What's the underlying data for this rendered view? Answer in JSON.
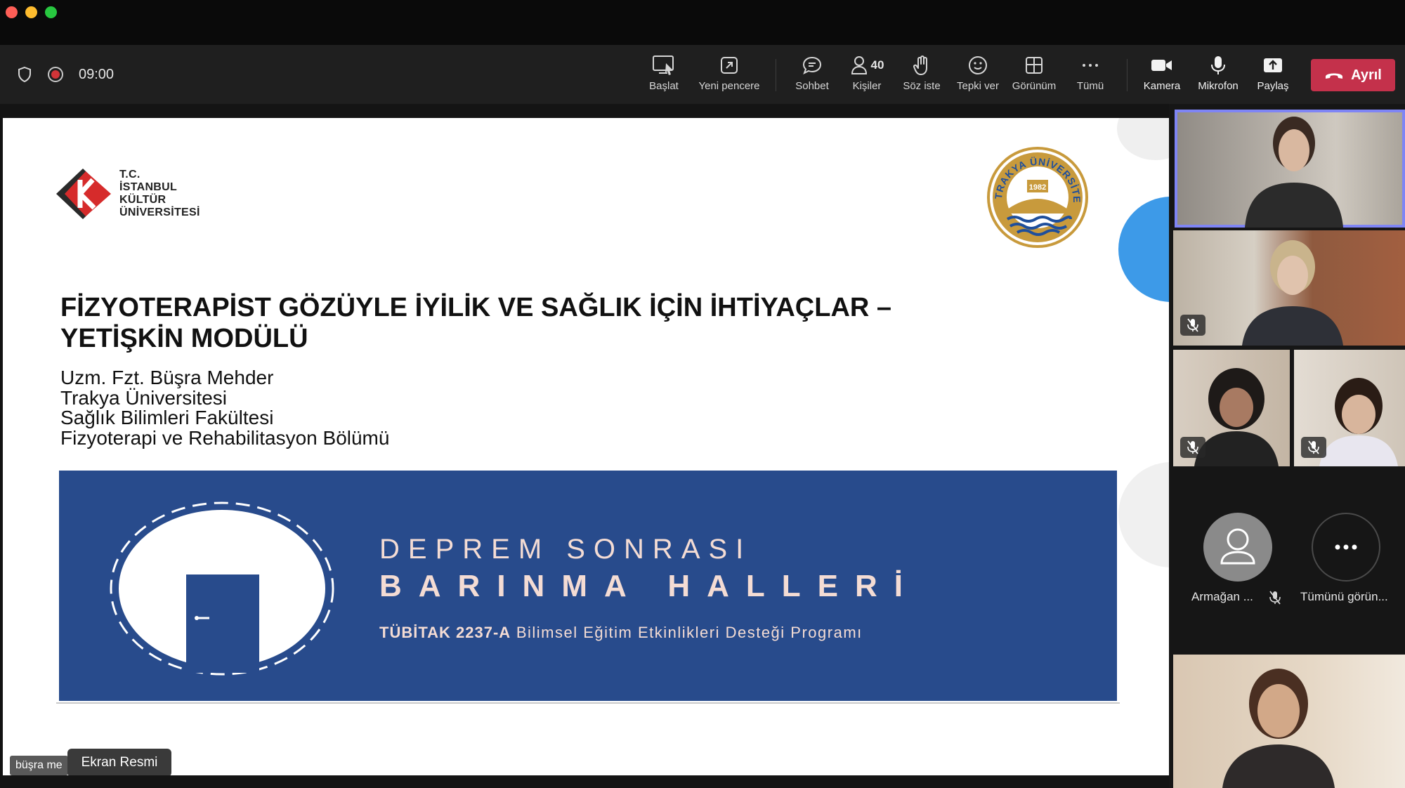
{
  "window": {
    "traffic_lights": [
      "close",
      "minimize",
      "zoom"
    ]
  },
  "toolbar": {
    "timer": "09:00",
    "start_label": "Başlat",
    "new_window_label": "Yeni pencere",
    "chat_label": "Sohbet",
    "people_label": "Kişiler",
    "people_count": "40",
    "raise_hand_label": "Söz iste",
    "react_label": "Tepki ver",
    "view_label": "Görünüm",
    "more_label": "Tümü",
    "camera_label": "Kamera",
    "mic_label": "Mikrofon",
    "share_label": "Paylaş",
    "leave_label": "Ayrıl",
    "leave_color": "#c4314b"
  },
  "slide": {
    "logo_left_lines": [
      "T.C.",
      "İSTANBUL",
      "KÜLTÜR",
      "ÜNİVERSİTESİ"
    ],
    "logo_right_top": "TRAKYA ÜNİVERSİTESİ",
    "logo_right_year": "1982",
    "title_line1": "FİZYOTERAPİST GÖZÜYLE İYİLİK VE SAĞLIK İÇİN İHTİYAÇLAR –",
    "title_line2": "YETİŞKİN MODÜLÜ",
    "author_lines": [
      "Uzm. Fzt. Büşra Mehder",
      "Trakya Üniversitesi",
      "Sağlık Bilimleri Fakültesi",
      "Fizyoterapi ve Rehabilitasyon Bölümü"
    ],
    "banner": {
      "line1": "DEPREM SONRASI",
      "line2": "BARINMA HALLERİ",
      "program_bold": "TÜBİTAK 2237-A",
      "program_rest": "Bilimsel Eğitim Etkinlikleri Desteği Programı",
      "bg_color": "#284b8c"
    },
    "presenter_chip": "büşra me",
    "tooltip": "Ekran Resmi"
  },
  "participants": {
    "overflow_name": "Armağan ...",
    "see_all_label": "Tümünü görün..."
  }
}
